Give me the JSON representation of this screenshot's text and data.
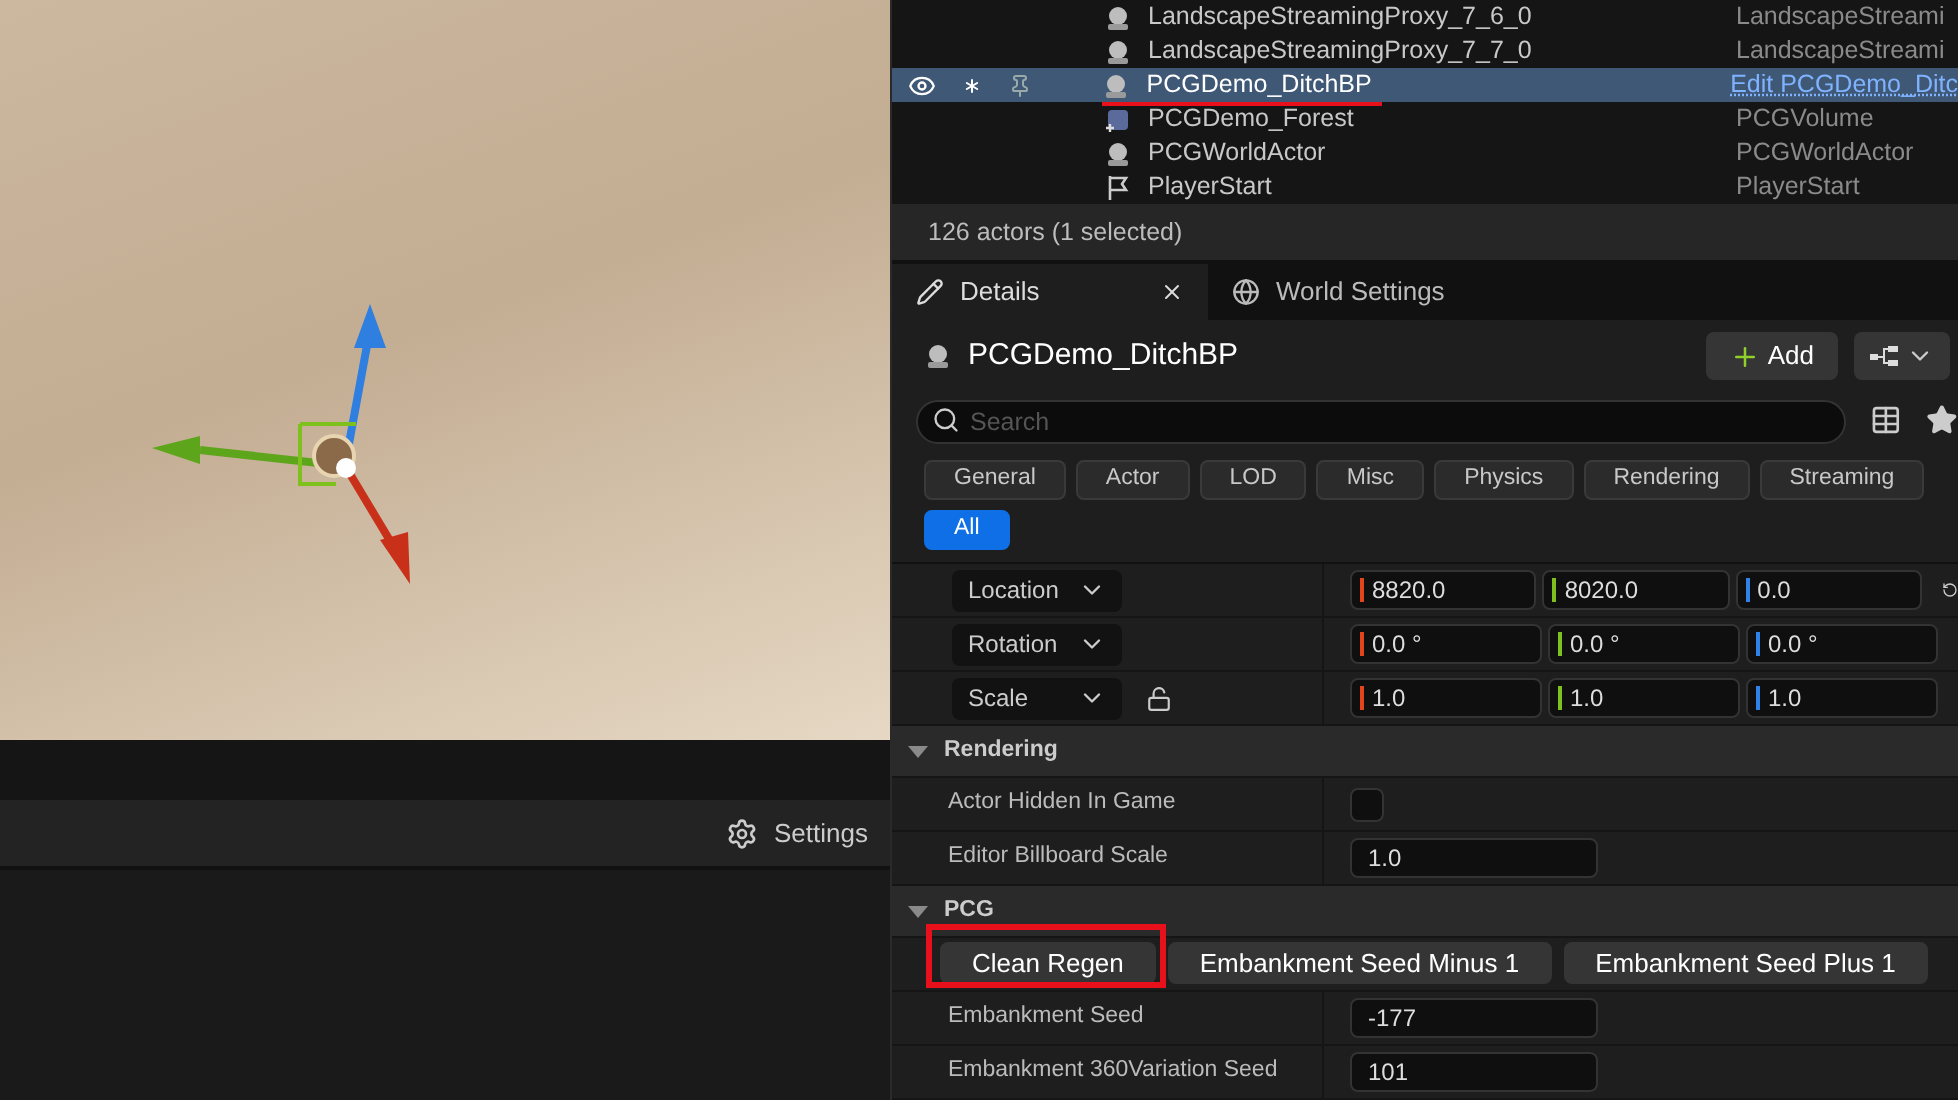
{
  "viewport_toolbar": {
    "settings_label": "Settings"
  },
  "outliner": {
    "rows": [
      {
        "name": "LandscapeStreamingProxy_7_6_0",
        "type": "LandscapeStreami",
        "selected": false,
        "kind": "actor"
      },
      {
        "name": "LandscapeStreamingProxy_7_7_0",
        "type": "LandscapeStreami",
        "selected": false,
        "kind": "actor"
      },
      {
        "name": "PCGDemo_DitchBP",
        "type": "Edit PCGDemo_Ditc",
        "selected": true,
        "kind": "actor"
      },
      {
        "name": "PCGDemo_Forest",
        "type": "PCGVolume",
        "selected": false,
        "kind": "volume"
      },
      {
        "name": "PCGWorldActor",
        "type": "PCGWorldActor",
        "selected": false,
        "kind": "actor"
      },
      {
        "name": "PlayerStart",
        "type": "PlayerStart",
        "selected": false,
        "kind": "start"
      }
    ],
    "status": "126 actors (1 selected)"
  },
  "details": {
    "tabs": [
      {
        "label": "Details",
        "selected": true
      },
      {
        "label": "World Settings",
        "selected": false
      }
    ],
    "actor_title": "PCGDemo_DitchBP",
    "add_label": "Add",
    "search": {
      "placeholder": "Search"
    },
    "filters": [
      {
        "label": "General",
        "selected": false
      },
      {
        "label": "Actor",
        "selected": false
      },
      {
        "label": "LOD",
        "selected": false
      },
      {
        "label": "Misc",
        "selected": false
      },
      {
        "label": "Physics",
        "selected": false
      },
      {
        "label": "Rendering",
        "selected": false
      },
      {
        "label": "Streaming",
        "selected": false
      },
      {
        "label": "All",
        "selected": true
      }
    ],
    "transform": [
      {
        "label": "Location",
        "values": [
          "8820.0",
          "8020.0",
          "0.0"
        ]
      },
      {
        "label": "Rotation",
        "values": [
          "0.0 °",
          "0.0 °",
          "0.0 °"
        ]
      },
      {
        "label": "Scale",
        "values": [
          "1.0",
          "1.0",
          "1.0"
        ]
      }
    ],
    "sections": [
      {
        "title": "Rendering",
        "expanded": true,
        "items": [
          {
            "kind": "checkbox",
            "label": "Actor Hidden In Game",
            "checked": false
          },
          {
            "kind": "number",
            "label": "Editor Billboard Scale",
            "value": "1.0"
          }
        ]
      },
      {
        "title": "PCG",
        "expanded": true,
        "items": [
          {
            "kind": "buttons",
            "labels": [
              "Clean Regen",
              "Embankment Seed Minus 1",
              "Embankment Seed Plus 1"
            ]
          },
          {
            "kind": "number",
            "label": "Embankment Seed",
            "value": "-177"
          },
          {
            "kind": "number",
            "label": "Embankment 360Variation Seed",
            "value": "101"
          }
        ]
      }
    ]
  }
}
